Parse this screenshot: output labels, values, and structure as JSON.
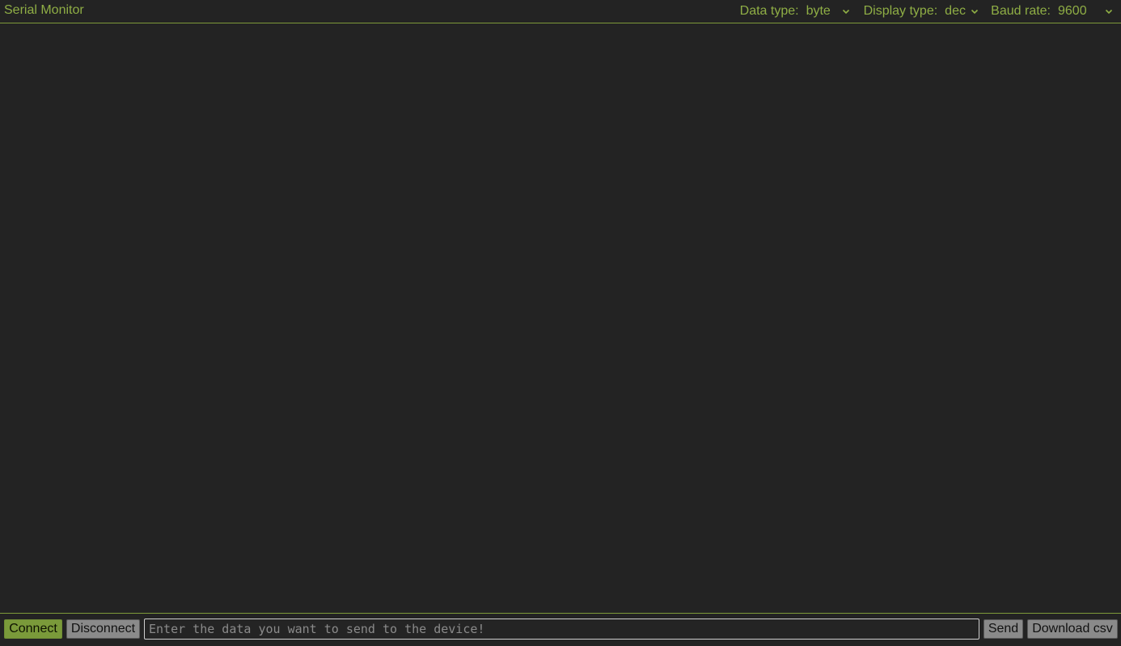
{
  "app": {
    "title": "Serial Monitor"
  },
  "header": {
    "data_type": {
      "label": "Data type:",
      "value": "byte"
    },
    "display_type": {
      "label": "Display type:",
      "value": "dec"
    },
    "baud_rate": {
      "label": "Baud rate:",
      "value": "9600"
    }
  },
  "footer": {
    "connect_label": "Connect",
    "disconnect_label": "Disconnect",
    "input_placeholder": "Enter the data you want to send to the device!",
    "send_label": "Send",
    "download_label": "Download csv"
  },
  "colors": {
    "accent": "#8fae45",
    "background": "#232323",
    "connect_button": "#7a9a3a",
    "secondary_button": "#8a8a8a"
  }
}
